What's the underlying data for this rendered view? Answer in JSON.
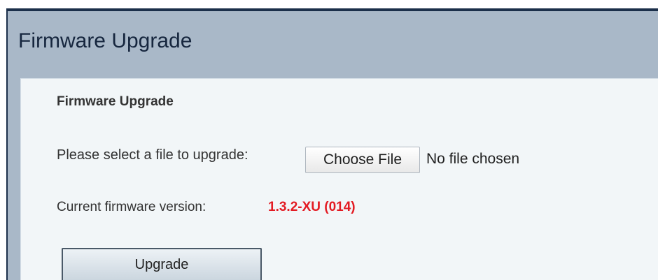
{
  "header": {
    "title": "Firmware Upgrade"
  },
  "section": {
    "title": "Firmware Upgrade"
  },
  "file_select": {
    "label": "Please select a file to upgrade:",
    "button_label": "Choose File",
    "status": "No file chosen"
  },
  "firmware": {
    "label": "Current firmware version:",
    "value": "1.3.2-XU (014)"
  },
  "actions": {
    "upgrade_label": "Upgrade"
  },
  "colors": {
    "page_background": "#a9b8c8",
    "content_background": "#f2f6f8",
    "border_dark": "#1b2f4a",
    "firmware_value": "#e31b23"
  }
}
